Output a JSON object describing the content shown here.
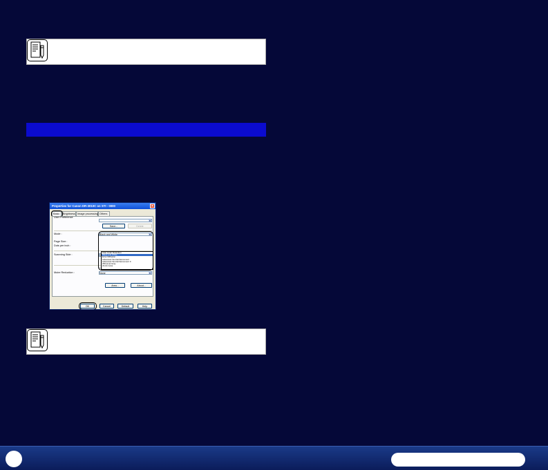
{
  "dialog": {
    "title": "Properties for Canon DR-3010C on STI - 0000",
    "close_label": "✕",
    "tabs": [
      "Basic",
      "Brightness",
      "Image processing",
      "Others"
    ],
    "labels": {
      "user_preference": "User Preference",
      "mode": "Mode :",
      "page_size": "Page Size :",
      "dots_per_inch": "Dots per inch :",
      "scanning_side": "Scanning Side :",
      "moire_reduction": "Moire Reduction :",
      "desktop": "Desktop"
    },
    "buttons": {
      "save": "Save...",
      "delete": "Delete",
      "settings": "Settings...",
      "area": "Area...",
      "about": "About...",
      "ok": "OK",
      "cancel": "Cancel",
      "default": "Default",
      "help": "Help"
    },
    "mode_value": "Black and White",
    "scanning_side_value": "Simplex",
    "moire_value": "None",
    "mode_options": [
      "Auto Color Detection",
      "Black and White",
      "Error Diffusion",
      "Advanced Text Enhancement",
      "Advanced Text Enhancement II",
      "256-level Gray",
      "24-bit Color"
    ],
    "selected_option_index": 1
  },
  "colors": {
    "background": "#050838",
    "section_bar": "#0b0bcf",
    "title_bar": "#0f4fd8"
  }
}
